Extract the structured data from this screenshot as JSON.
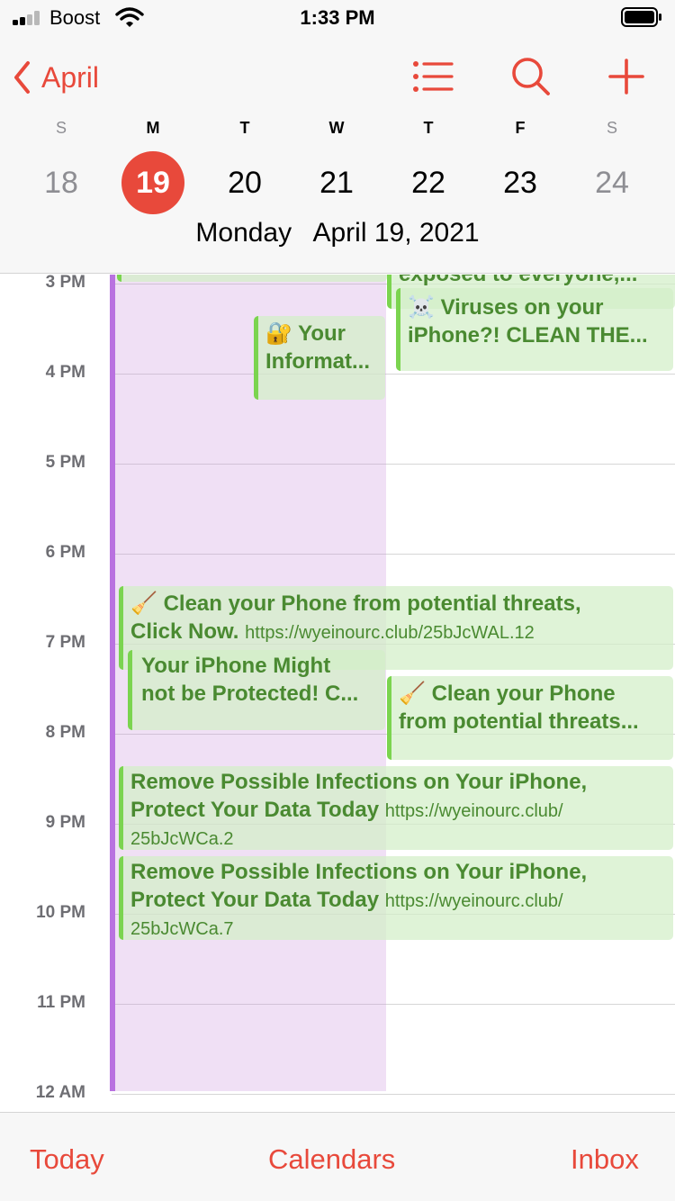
{
  "status_bar": {
    "carrier": "Boost",
    "time": "1:33 PM"
  },
  "header": {
    "back_label": "April",
    "toolbar": {
      "list_icon": "list-icon",
      "search_icon": "search-icon",
      "add_icon": "plus-icon"
    },
    "weekdays": [
      "S",
      "M",
      "T",
      "W",
      "T",
      "F",
      "S"
    ],
    "dates": [
      "18",
      "19",
      "20",
      "21",
      "22",
      "23",
      "24"
    ],
    "selected_date": "19",
    "selected_full_date": "Monday   April 19, 2021"
  },
  "timeline": {
    "hours": [
      "3 PM",
      "4 PM",
      "5 PM",
      "6 PM",
      "7 PM",
      "8 PM",
      "9 PM",
      "10 PM",
      "11 PM",
      "12 AM"
    ],
    "events": {
      "partial_top_right": "exposed to everyone,...",
      "viruses": {
        "emoji": "☠️",
        "line1": "Viruses on your",
        "line2": "iPhone?! CLEAN THE..."
      },
      "your_info": {
        "emoji": "🔐",
        "line1": "Your",
        "line2": "Informat..."
      },
      "clean_phone_wide": {
        "emoji": "🧹",
        "line1": "Clean your Phone from potential threats,",
        "line2": "Click Now.",
        "url": "https://wyeinourc.club/25bJcWAL.12"
      },
      "might_not_protected": {
        "line1": "Your iPhone Might",
        "line2": "not be Protected! C..."
      },
      "clean_phone_right": {
        "emoji": "🧹",
        "line1": "Clean your Phone",
        "line2": "from potential threats..."
      },
      "remove_infections_1": {
        "line1": "Remove Possible Infections on Your iPhone,",
        "line2": "Protect Your Data Today",
        "url_a": "https://wyeinourc.club/",
        "url_b": "25bJcWCa.2"
      },
      "remove_infections_2": {
        "line1": "Remove Possible Infections on Your iPhone,",
        "line2": "Protect Your Data Today",
        "url_a": "https://wyeinourc.club/",
        "url_b": "25bJcWCa.7"
      }
    }
  },
  "tabbar": {
    "today": "Today",
    "calendars": "Calendars",
    "inbox": "Inbox"
  },
  "colors": {
    "accent": "#e8493b",
    "event_green": "#7bd44f",
    "event_text": "#4a8a31",
    "allday_purple": "#b972e0"
  }
}
